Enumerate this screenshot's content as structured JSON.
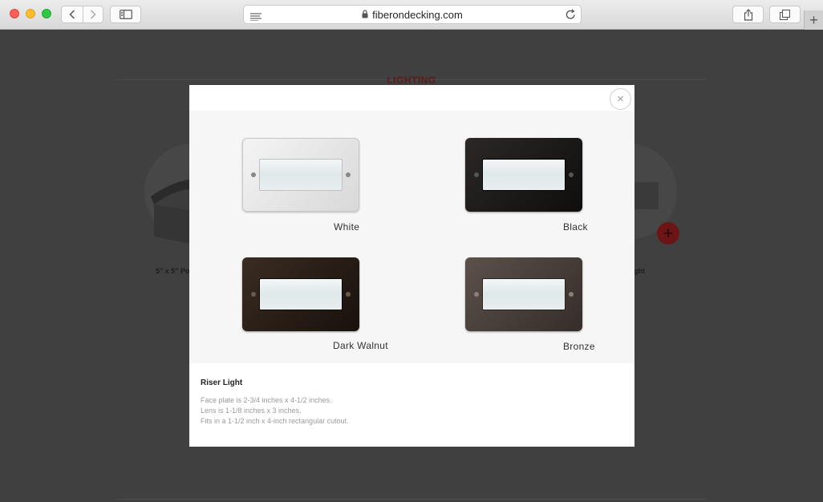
{
  "browser": {
    "url": "fiberondecking.com",
    "new_tab_label": "+"
  },
  "page": {
    "section_title": "LIGHTING",
    "left_caption": "5\" x 5\" Po",
    "right_caption": "ght",
    "add_label": "+"
  },
  "modal": {
    "close_label": "×",
    "swatches": [
      {
        "label": "White",
        "plate_color": "#e8e8e8",
        "frame_color": "#d9d9d9"
      },
      {
        "label": "Black",
        "plate_color": "#1c1a19",
        "frame_color": "#0f0e0d"
      },
      {
        "label": "Dark Walnut",
        "plate_color": "#2a2019",
        "frame_color": "#1a130e"
      },
      {
        "label": "Bronze",
        "plate_color": "#4a403b",
        "frame_color": "#352d29"
      }
    ],
    "product_title": "Riser Light",
    "details": [
      "Face plate is 2-3/4 inches x 4-1/2 inches.",
      "Lens is 1-1/8 inches x 3 inches.",
      "Fits in a 1-1/2 inch x 4-inch rectangular cutout."
    ]
  }
}
